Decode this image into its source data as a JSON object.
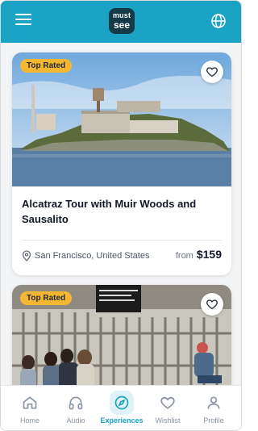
{
  "app": {
    "logo_line1": "must",
    "logo_line2": "see",
    "brand_color": "#1aa3c4"
  },
  "header": {
    "menu_icon": "hamburger-menu-icon",
    "language_icon": "globe-icon"
  },
  "cards": [
    {
      "badge": "Top Rated",
      "title": "Alcatraz Tour with Muir Woods and Sausalito",
      "location": "San Francisco, United States",
      "price_prefix": "from",
      "price": "$159",
      "favorite_icon": "heart-outline-icon"
    },
    {
      "badge": "Top Rated",
      "favorite_icon": "heart-outline-icon"
    }
  ],
  "nav": {
    "items": [
      {
        "label": "Home",
        "icon": "home-icon"
      },
      {
        "label": "Audio",
        "icon": "headphones-icon"
      },
      {
        "label": "Experiences",
        "icon": "compass-icon"
      },
      {
        "label": "Wishlist",
        "icon": "heart-icon"
      },
      {
        "label": "Profile",
        "icon": "user-icon"
      }
    ],
    "active": "Experiences"
  }
}
